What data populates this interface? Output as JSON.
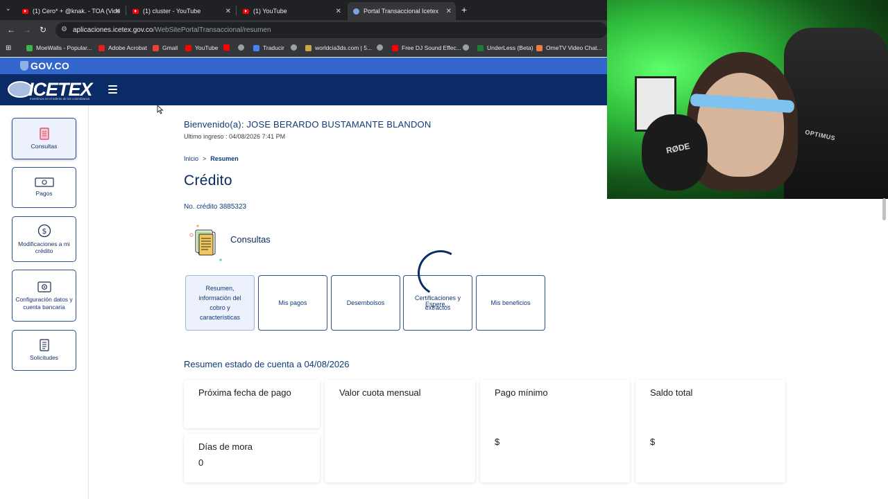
{
  "browser": {
    "tabs": [
      {
        "title": "(1) Cero* + @knak. - TOA (Vide",
        "active": false
      },
      {
        "title": "(1) cluster - YouTube",
        "active": false
      },
      {
        "title": "(1) YouTube",
        "active": false
      },
      {
        "title": "Portal Transaccional Icetex",
        "active": true
      }
    ],
    "url_domain": "aplicaciones.icetex.gov.co",
    "url_path": "/WebSitePortalTransaccional/resumen",
    "bookmarks": [
      "MoeWalls - Popular...",
      "Adobe Acrobat",
      "Gmail",
      "YouTube",
      "Traducir",
      "worldcia3ds.com | 5...",
      "Free DJ Sound Effec...",
      "UnderLess (Beta)",
      "OmeTV Video Chat..."
    ]
  },
  "gov": {
    "label": "GOV.CO"
  },
  "header": {
    "logo": "ICETEX",
    "tagline": "Invertimos en el talento de los colombianos"
  },
  "sidebar": {
    "items": [
      {
        "label": "Consultas"
      },
      {
        "label": "Pagos"
      },
      {
        "label": "Modificaciones a mi crédito"
      },
      {
        "label": "Configuración datos y cuenta bancaria"
      },
      {
        "label": "Solicitudes"
      }
    ]
  },
  "main": {
    "welcome": "Bienvenido(a): JOSE BERARDO BUSTAMANTE BLANDON",
    "last_login": "Ultimo ingreso : 04/08/2026 7:41 PM",
    "breadcrumb": {
      "home": "Inicio",
      "sep": ">",
      "current": "Resumen"
    },
    "title": "Crédito",
    "credit_number": "No. crédito 3885323",
    "section_title": "Consultas",
    "query_buttons": [
      "Resumen, información del cobro y características",
      "Mis pagos",
      "Desembolsos",
      "Certificaciones y extractos",
      "Mis beneficios"
    ],
    "loading_text": "Espere...",
    "summary_title": "Resumen estado de cuenta a 04/08/2026",
    "cards": {
      "next_payment": {
        "label": "Próxima fecha de pago"
      },
      "monthly": {
        "label": "Valor cuota mensual"
      },
      "minimum": {
        "label": "Pago mínimo",
        "value": "$"
      },
      "total": {
        "label": "Saldo total",
        "value": "$"
      },
      "arrears": {
        "label": "Días de mora",
        "value": "0"
      }
    }
  },
  "webcam": {
    "mic_brand": "RØDE",
    "chair_brand": "OPTIMUS"
  }
}
